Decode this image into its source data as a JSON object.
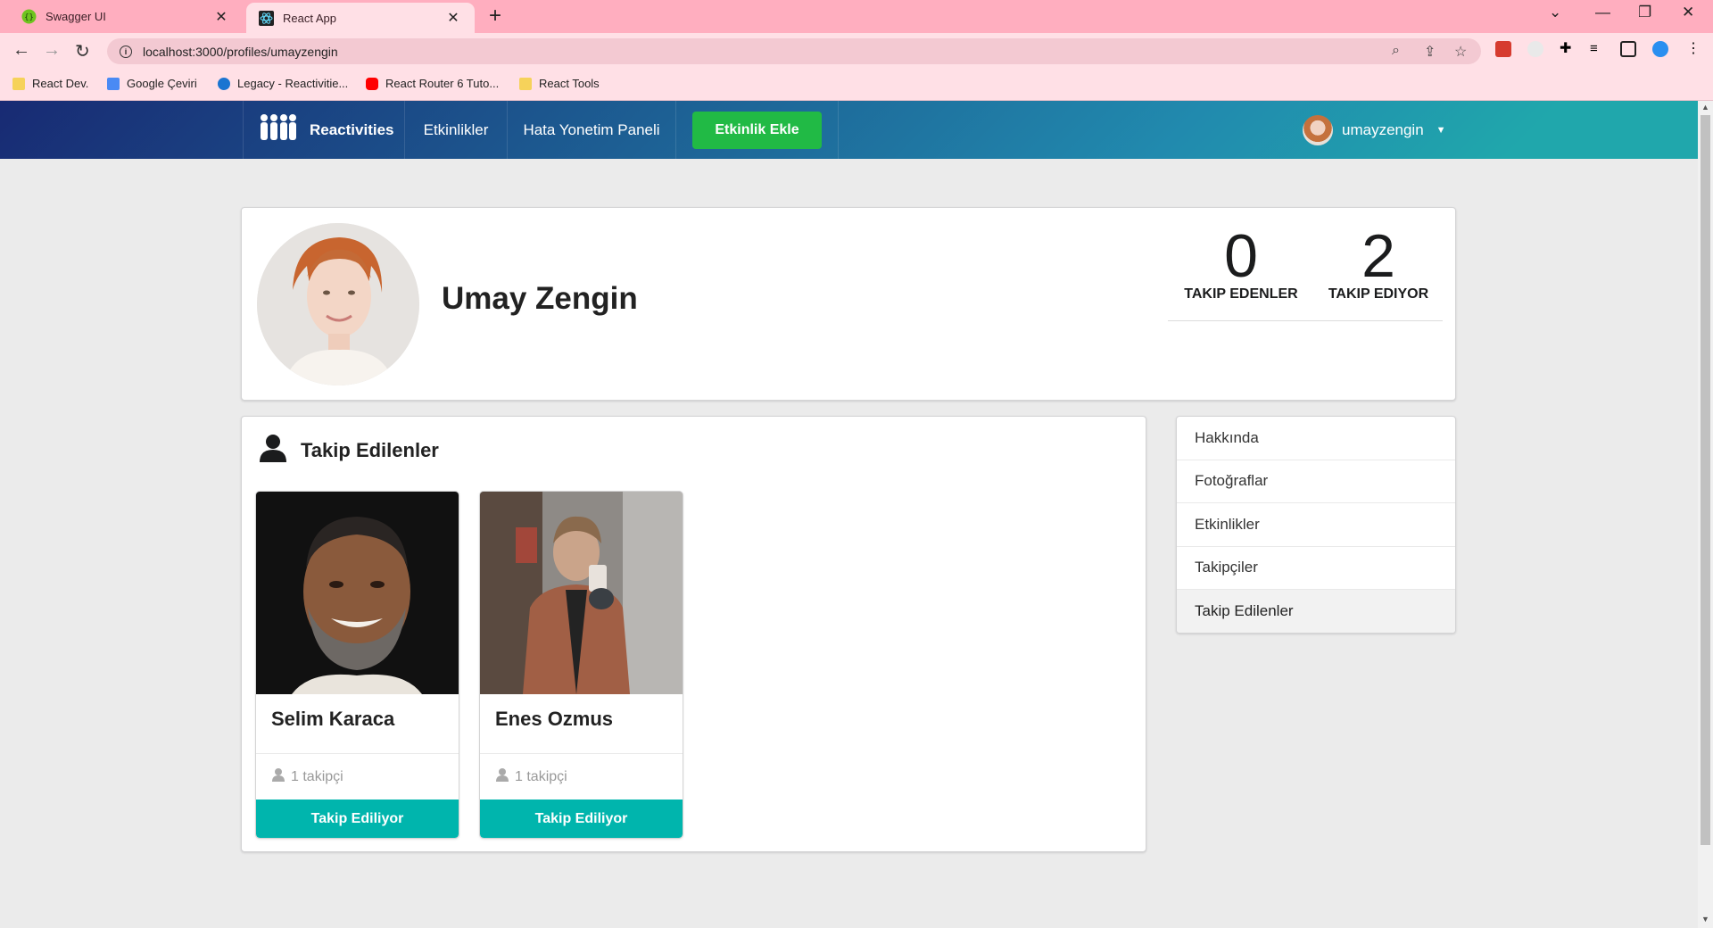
{
  "browser": {
    "tabs": [
      {
        "title": "Swagger UI",
        "close": "✕"
      },
      {
        "title": "React App",
        "close": "✕"
      }
    ],
    "new_tab": "+",
    "url": "localhost:3000/profiles/umayzengin",
    "bookmarks": [
      "React Dev.",
      "Google Çeviri",
      "Legacy - Reactivitie...",
      "React Router 6 Tuto...",
      "React Tools"
    ]
  },
  "navbar": {
    "brand": "Reactivities",
    "events": "Etkinlikler",
    "error_panel": "Hata Yonetim Paneli",
    "add_event": "Etkinlik Ekle",
    "username": "umayzengin"
  },
  "profile": {
    "name": "Umay Zengin",
    "followers_count": "0",
    "followers_label": "TAKIP EDENLER",
    "following_count": "2",
    "following_label": "TAKIP EDIYOR"
  },
  "following_panel": {
    "title": "Takip Edilenler",
    "cards": [
      {
        "name": "Selim Karaca",
        "followers": "1 takipçi",
        "button": "Takip Ediliyor"
      },
      {
        "name": "Enes Ozmus",
        "followers": "1 takipçi",
        "button": "Takip Ediliyor"
      }
    ]
  },
  "side_menu": {
    "items": [
      "Hakkında",
      "Fotoğraflar",
      "Etkinlikler",
      "Takipçiler",
      "Takip Edilenler"
    ],
    "active": "Takip Edilenler"
  },
  "colors": {
    "tab_bar": "#ffaebf",
    "nav_gradient_start": "#182a73",
    "nav_gradient_end": "#20a7ac",
    "add_button": "#21ba45",
    "follow_button": "#00b5ad"
  }
}
